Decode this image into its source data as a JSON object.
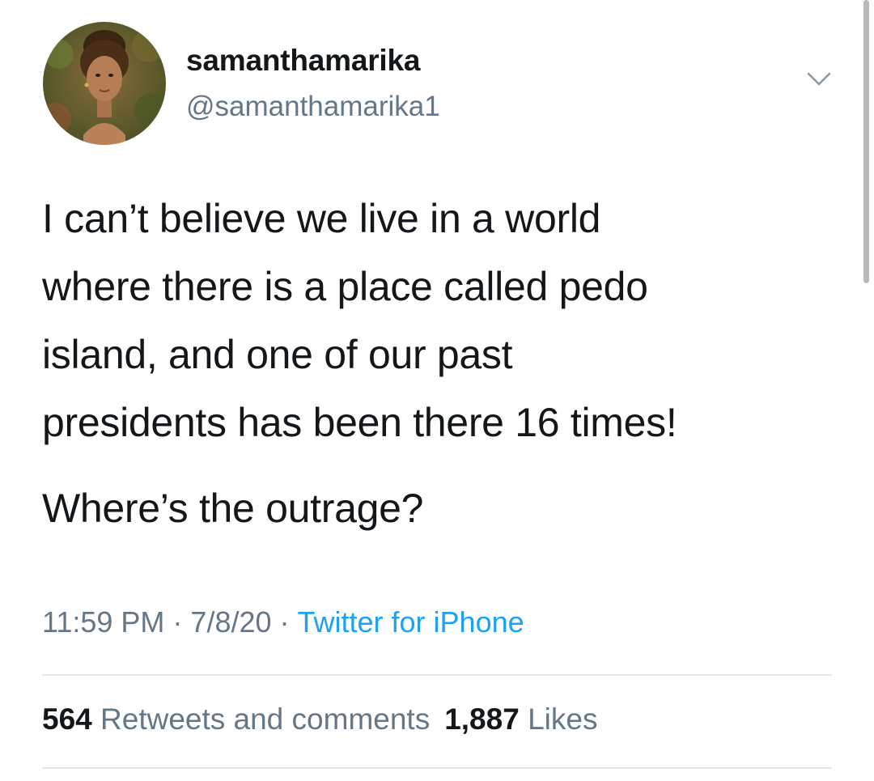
{
  "user": {
    "display_name": "samanthamarika",
    "handle": "@samanthamarika1"
  },
  "tweet": {
    "lines_paragraph_1": [
      "I can’t believe we live in a world",
      "where there is a place called pedo",
      "island, and one of our past",
      "presidents has been there 16 times!"
    ],
    "paragraph_2": "Where’s the outrage?",
    "time": "11:59 PM",
    "separator": "·",
    "date": "7/8/20",
    "source": "Twitter for iPhone"
  },
  "stats": {
    "retweets_count": "564",
    "retweets_label": "Retweets and comments",
    "likes_count": "1,887",
    "likes_label": "Likes"
  },
  "icons": {
    "caret": "chevron-down-icon"
  },
  "colors": {
    "text": "#14171a",
    "secondary": "#657786",
    "link": "#1da1f2",
    "divider": "#e1e8ed"
  }
}
